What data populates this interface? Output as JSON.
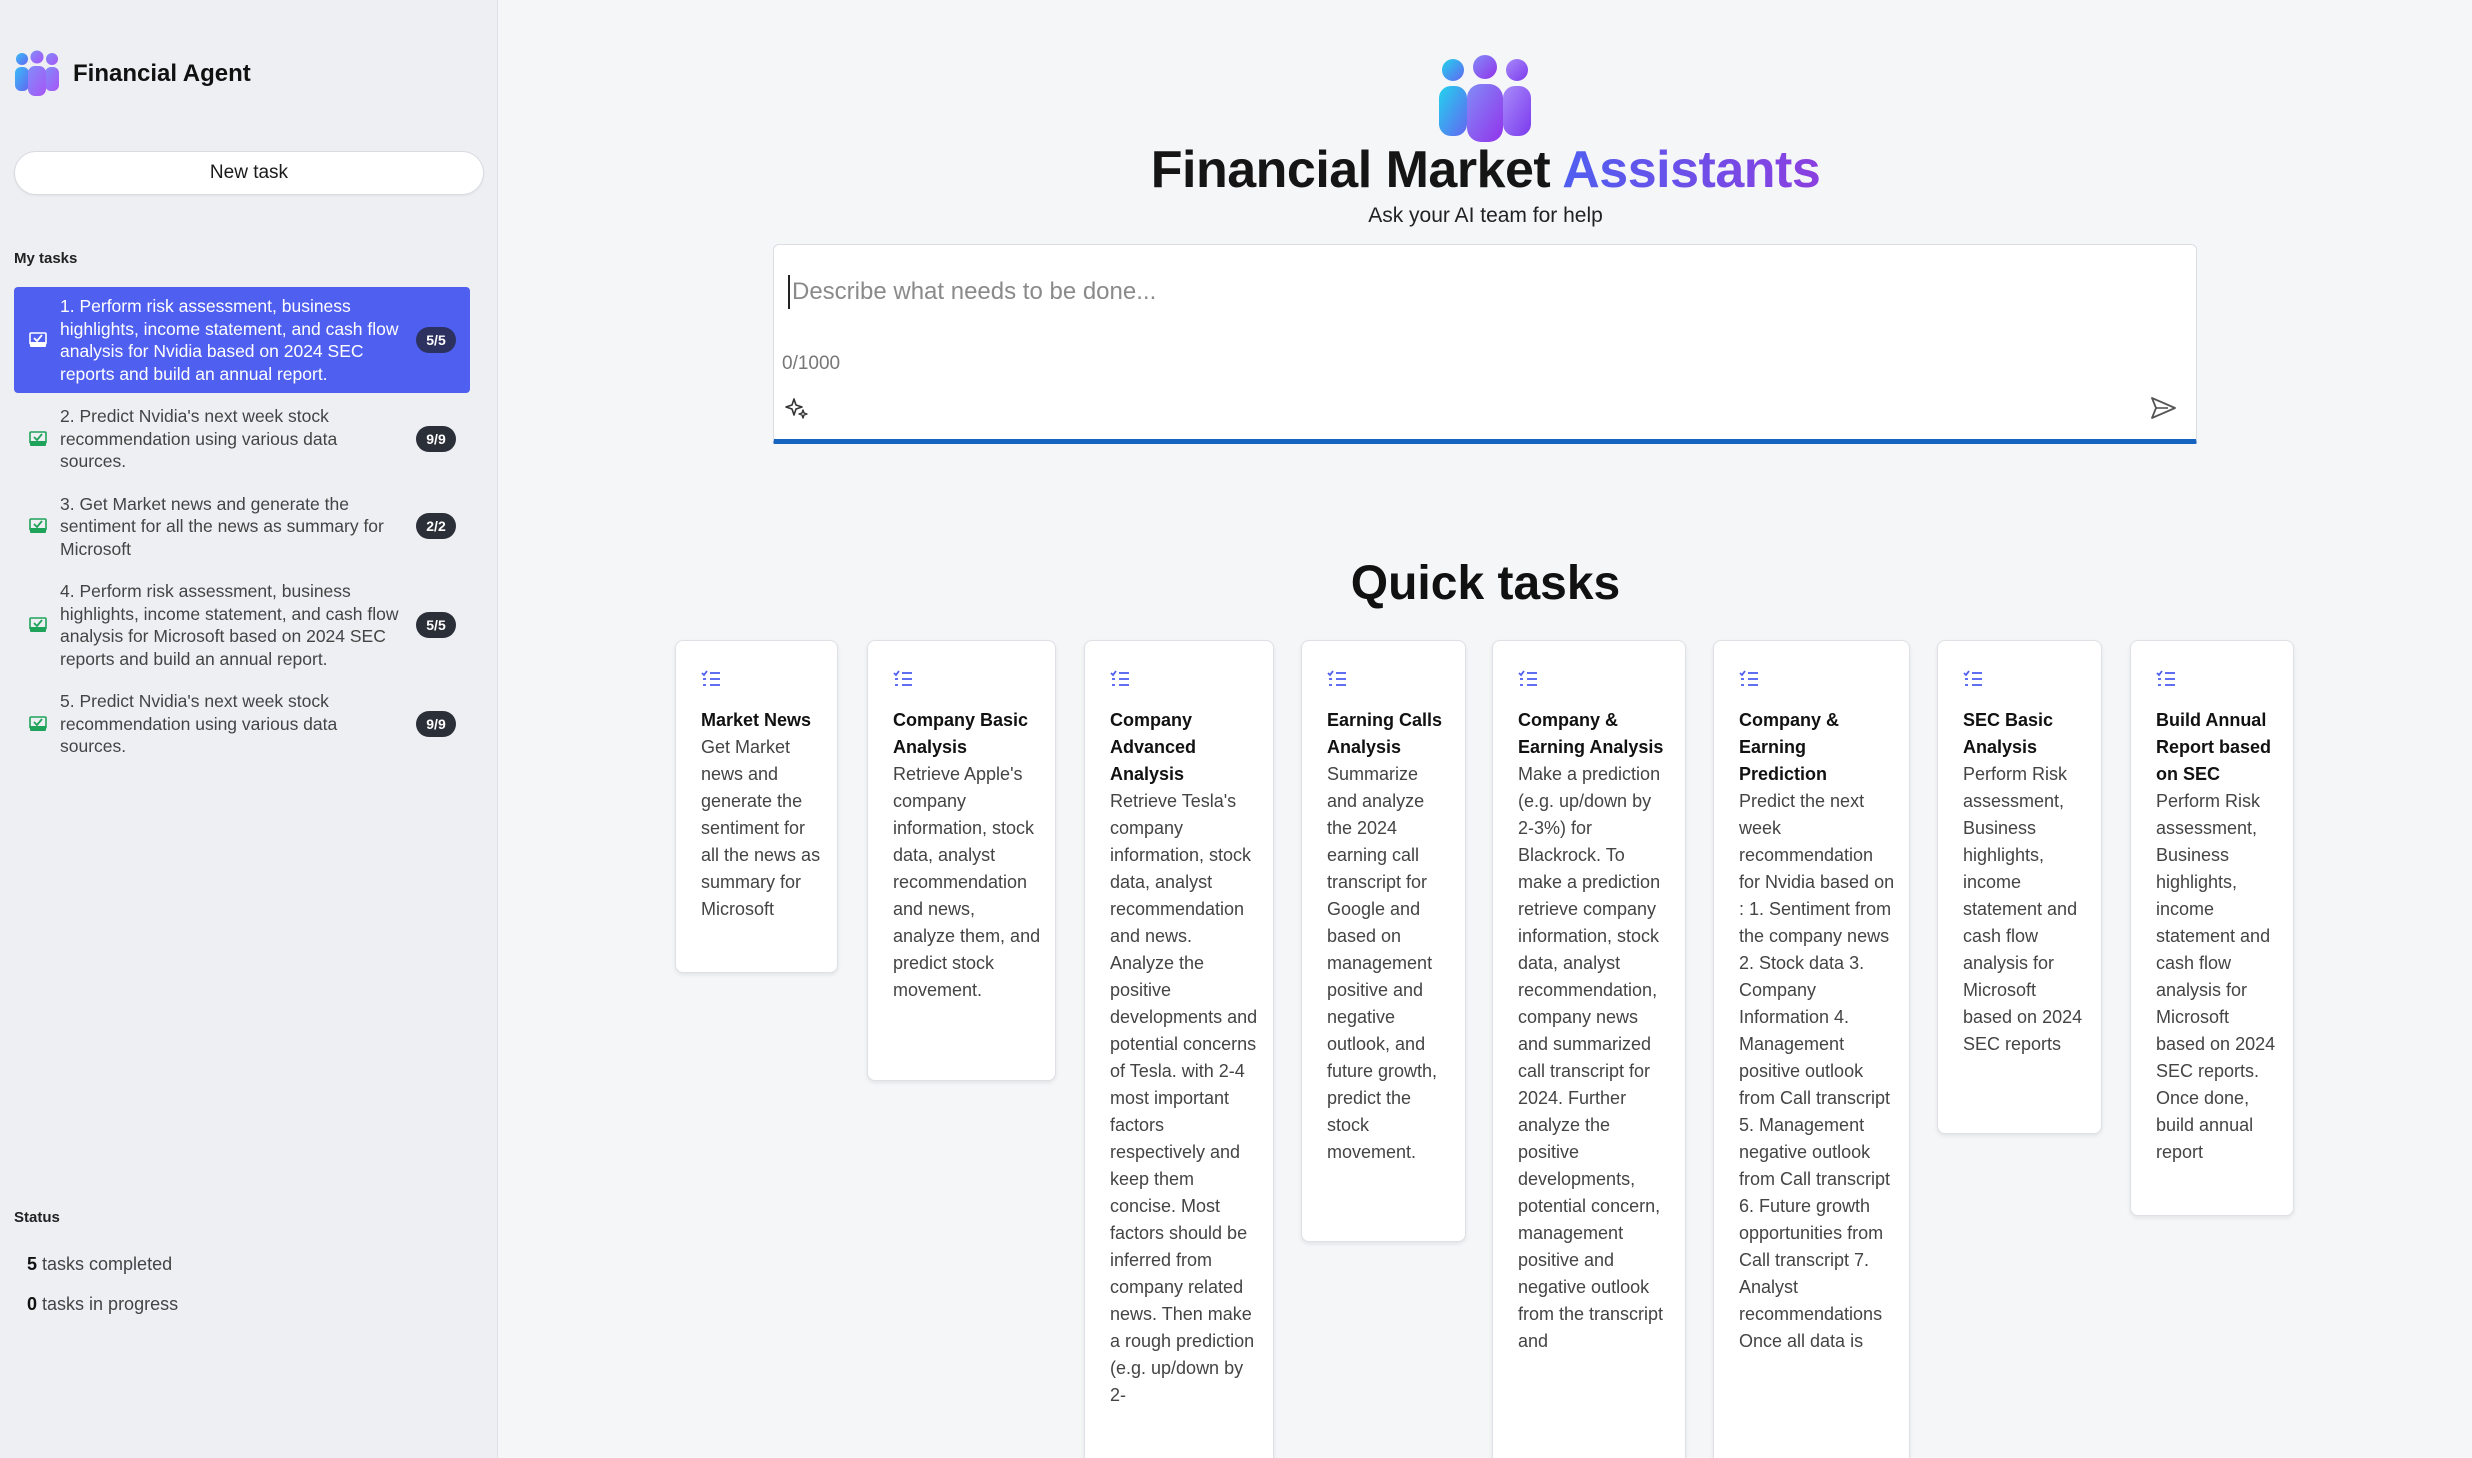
{
  "app": {
    "title": "Financial Agent",
    "new_task_label": "New task"
  },
  "sidebar": {
    "my_tasks_label": "My tasks",
    "tasks": [
      {
        "text": "1. Perform risk assessment, business highlights, income statement, and cash flow analysis for Nvidia based on 2024 SEC reports and build an annual report.",
        "badge": "5/5",
        "active": true
      },
      {
        "text": "2. Predict Nvidia's next week stock recommendation using various data sources.",
        "badge": "9/9",
        "active": false
      },
      {
        "text": "3. Get Market news and generate the sentiment for all the news as summary for Microsoft",
        "badge": "2/2",
        "active": false
      },
      {
        "text": "4. Perform risk assessment, business highlights, income statement, and cash flow analysis for Microsoft based on 2024 SEC reports and build an annual report.",
        "badge": "5/5",
        "active": false
      },
      {
        "text": "5. Predict Nvidia's next week stock recommendation using various data sources.",
        "badge": "9/9",
        "active": false
      }
    ],
    "status_label": "Status",
    "completed_count": "5",
    "completed_label": "tasks completed",
    "in_progress_count": "0",
    "in_progress_label": "tasks in progress"
  },
  "hero": {
    "title_part1": "Financial Market",
    "title_part2": "Assistants",
    "subtitle": "Ask your AI team for help"
  },
  "prompt": {
    "placeholder": "Describe what needs to be done...",
    "char_count": "0/1000"
  },
  "quick_tasks": {
    "title": "Quick tasks",
    "cards": [
      {
        "title": "Market News",
        "desc": "Get Market news and generate the sentiment for all the news as summary for Microsoft"
      },
      {
        "title": "Company Basic Analysis",
        "desc": "Retrieve Apple's company information, stock data, analyst recommendation and news, analyze them, and predict stock movement."
      },
      {
        "title": "Company Advanced Analysis",
        "desc": "Retrieve Tesla's company information, stock data, analyst recommendation and news. Analyze the positive developments and potential concerns of Tesla. with 2-4 most important factors respectively and keep them concise. Most factors should be inferred from company related news. Then make a rough prediction (e.g. up/down by 2-"
      },
      {
        "title": "Earning Calls Analysis",
        "desc": "Summarize and analyze the 2024 earning call transcript for Google and based on management positive and negative outlook, and future growth, predict the stock movement."
      },
      {
        "title": "Company & Earning Analysis",
        "desc": "Make a prediction (e.g. up/down by 2-3%) for Blackrock. To make a prediction retrieve company information, stock data, analyst recommendation, company news and summarized call transcript for 2024. Further analyze the positive developments, potential concern, management positive and negative outlook from the transcript and"
      },
      {
        "title": "Company & Earning Prediction",
        "desc": "Predict the next week recommendation for Nvidia based on : 1. Sentiment from the company news 2. Stock data 3. Company Information 4. Management positive outlook from Call transcript 5. Management negative outlook from Call transcript 6. Future growth opportunities from Call transcript 7. Analyst recommendations Once all data is"
      },
      {
        "title": "SEC Basic Analysis",
        "desc": "Perform Risk assessment, Business highlights, income statement and cash flow analysis for Microsoft based on 2024 SEC reports"
      },
      {
        "title": "Build Annual Report based on SEC",
        "desc": "Perform Risk assessment, Business highlights, income statement and cash flow analysis for Microsoft based on 2024 SEC reports. Once done, build annual report"
      }
    ]
  },
  "colors": {
    "accent": "#4f5ff0",
    "accent_purple": "#8b3fe0",
    "check_green": "#1fa35a",
    "prompt_underline": "#1565c0"
  },
  "icons": {
    "brand": "team-people-icon",
    "task_done": "task-done-icon",
    "sparkle": "sparkle-icon",
    "send": "send-icon",
    "card": "task-list-icon"
  }
}
